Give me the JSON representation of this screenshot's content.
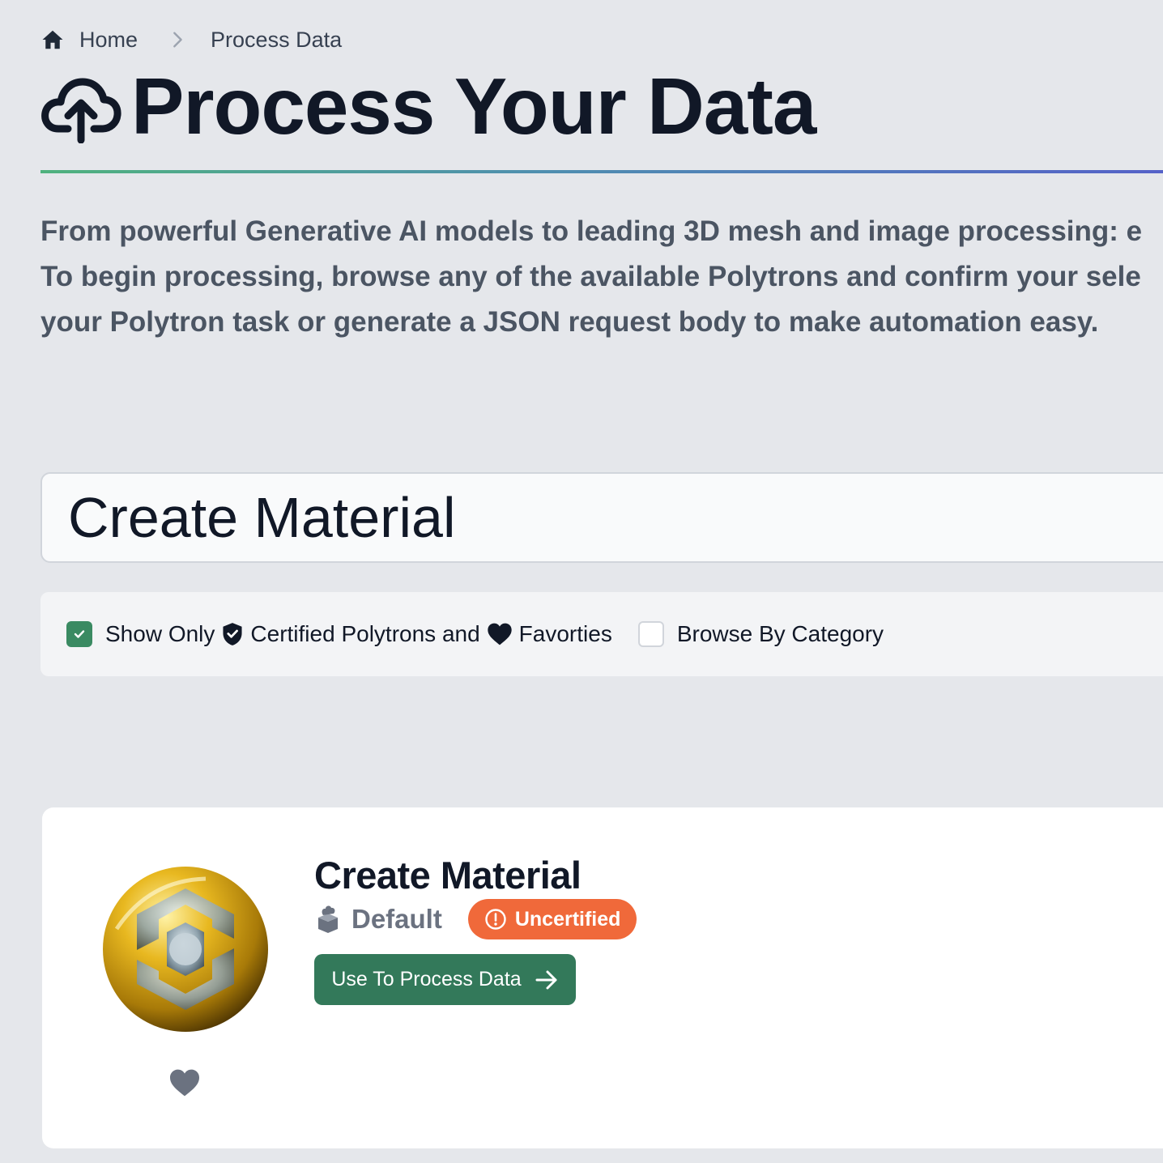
{
  "breadcrumb": {
    "home_label": "Home",
    "current_label": "Process Data"
  },
  "header": {
    "title": "Process Your Data"
  },
  "description": {
    "line1": "From powerful Generative AI models to leading 3D mesh and image processing: e",
    "line2": "To begin processing, browse any of the available Polytrons and confirm your sele",
    "line3": "your Polytron task or generate a JSON request body to make automation easy."
  },
  "search": {
    "value": "Create Material"
  },
  "filters": {
    "show_only_label": "Show Only",
    "certified_label": "Certified Polytrons and",
    "favorites_label": "Favorties",
    "browse_category_label": "Browse By Category",
    "show_only_checked": true,
    "browse_category_checked": false
  },
  "result": {
    "title": "Create Material",
    "package": "Default",
    "badge": "Uncertified",
    "action_label": "Use To Process Data"
  },
  "colors": {
    "accent_green": "#33795a",
    "badge_orange": "#f0693a",
    "gold": "#d9a520"
  },
  "icons": [
    "home-icon",
    "chevron-right-icon",
    "cloud-upload-icon",
    "check-icon",
    "shield-check-icon",
    "heart-icon",
    "package-icon",
    "alert-circle-icon",
    "arrow-right-icon"
  ]
}
